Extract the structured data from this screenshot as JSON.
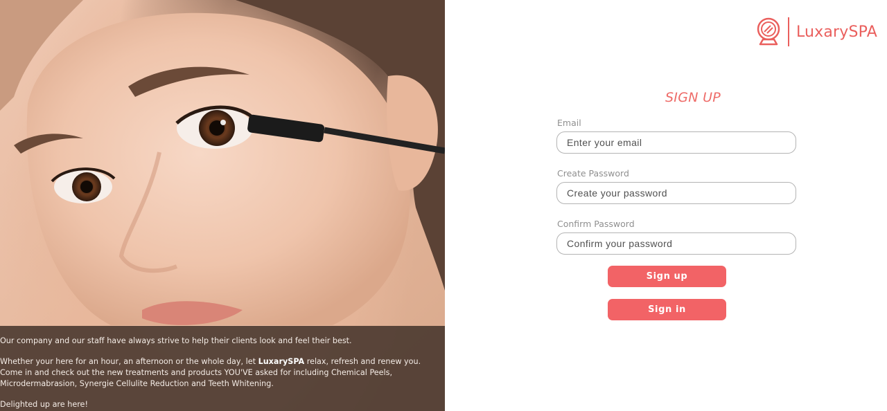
{
  "brand": {
    "name": "LuxarySPA",
    "accent_color": "#EA5F5D",
    "icon": "mirror-logo-icon"
  },
  "hero": {
    "image": "woman-applying-mascara-photo",
    "caption": {
      "paragraph1": "Our company and our staff have always strive to help their clients look and feel their best.",
      "paragraph2_before": "Whether your here for an hour, an afternoon or the whole day, let ",
      "paragraph2_brand": "LuxarySPA",
      "paragraph2_after": " relax, refresh and renew you. Come in and check out the new treatments and products YOU'VE asked for including Chemical Peels, Microdermabrasion, Synergie Cellulite Reduction and Teeth Whitening.",
      "paragraph3": "Delighted up are here!"
    }
  },
  "form": {
    "title": "SIGN UP",
    "email": {
      "label": "Email",
      "placeholder": "Enter your email",
      "value": ""
    },
    "password": {
      "label": "Create Password",
      "placeholder": "Create your password",
      "value": ""
    },
    "confirm_password": {
      "label": "Confirm Password",
      "placeholder": "Confirm your password",
      "value": ""
    },
    "signup_button": "Sign up",
    "signin_button": "Sign in",
    "button_color": "#F26366"
  }
}
